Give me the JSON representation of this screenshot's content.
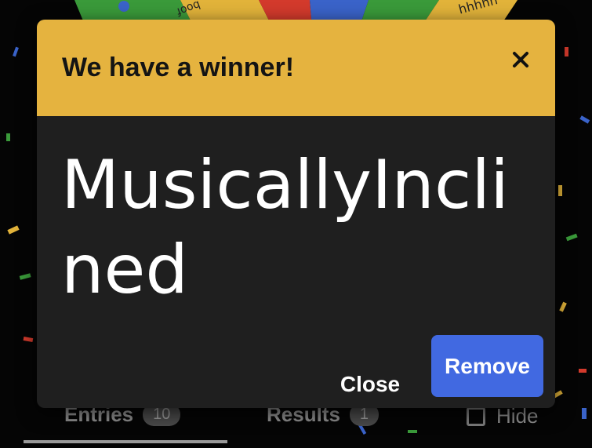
{
  "dialog": {
    "title": "We have a winner!",
    "close_icon": "close-icon",
    "winner": "MusicallyInclined",
    "close_label": "Close",
    "remove_label": "Remove",
    "header_color": "#e5b33f",
    "remove_color": "#4169e1"
  },
  "background": {
    "wheel_segment_texts": [
      "boof",
      "hhhhh"
    ]
  },
  "tabs": {
    "entries_label": "Entries",
    "entries_count": "10",
    "results_label": "Results",
    "results_count": "1",
    "hide_label": "Hide"
  }
}
